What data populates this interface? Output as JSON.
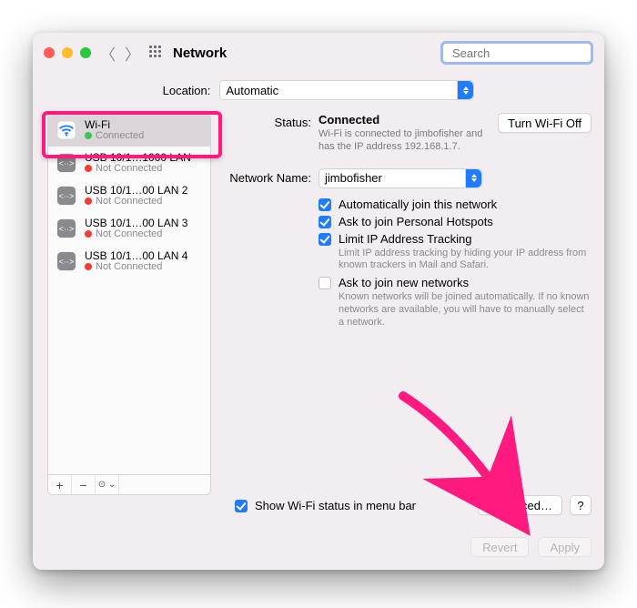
{
  "window": {
    "title": "Network"
  },
  "search": {
    "placeholder": "Search"
  },
  "location": {
    "label": "Location:",
    "value": "Automatic"
  },
  "sidebar": {
    "items": [
      {
        "name": "Wi-Fi",
        "status": "Connected",
        "color": "green",
        "selected": true,
        "icon": "wifi"
      },
      {
        "name": "USB 10/1…1000 LAN",
        "status": "Not Connected",
        "color": "red",
        "selected": false,
        "icon": "eth"
      },
      {
        "name": "USB 10/1…00 LAN 2",
        "status": "Not Connected",
        "color": "red",
        "selected": false,
        "icon": "eth"
      },
      {
        "name": "USB 10/1…00 LAN 3",
        "status": "Not Connected",
        "color": "red",
        "selected": false,
        "icon": "eth"
      },
      {
        "name": "USB 10/1…00 LAN 4",
        "status": "Not Connected",
        "color": "red",
        "selected": false,
        "icon": "eth"
      }
    ],
    "footer": {
      "add": "+",
      "remove": "−",
      "more": "☉⌄"
    }
  },
  "main": {
    "status_label": "Status:",
    "status_value": "Connected",
    "status_sub": "Wi-Fi is connected to jimbofisher and has the IP address 192.168.1.7.",
    "wifi_toggle": "Turn Wi-Fi Off",
    "network_name_label": "Network Name:",
    "network_name_value": "jimbofisher",
    "checks": [
      {
        "checked": true,
        "label": "Automatically join this network",
        "sub": ""
      },
      {
        "checked": true,
        "label": "Ask to join Personal Hotspots",
        "sub": ""
      },
      {
        "checked": true,
        "label": "Limit IP Address Tracking",
        "sub": "Limit IP address tracking by hiding your IP address from known trackers in Mail and Safari."
      },
      {
        "checked": false,
        "label": "Ask to join new networks",
        "sub": "Known networks will be joined automatically. If no known networks are available, you will have to manually select a network."
      }
    ]
  },
  "footer": {
    "menubar_check": true,
    "menubar_label": "Show Wi-Fi status in menu bar",
    "advanced": "Advanced…",
    "help": "?"
  },
  "bottom": {
    "revert": "Revert",
    "apply": "Apply"
  }
}
